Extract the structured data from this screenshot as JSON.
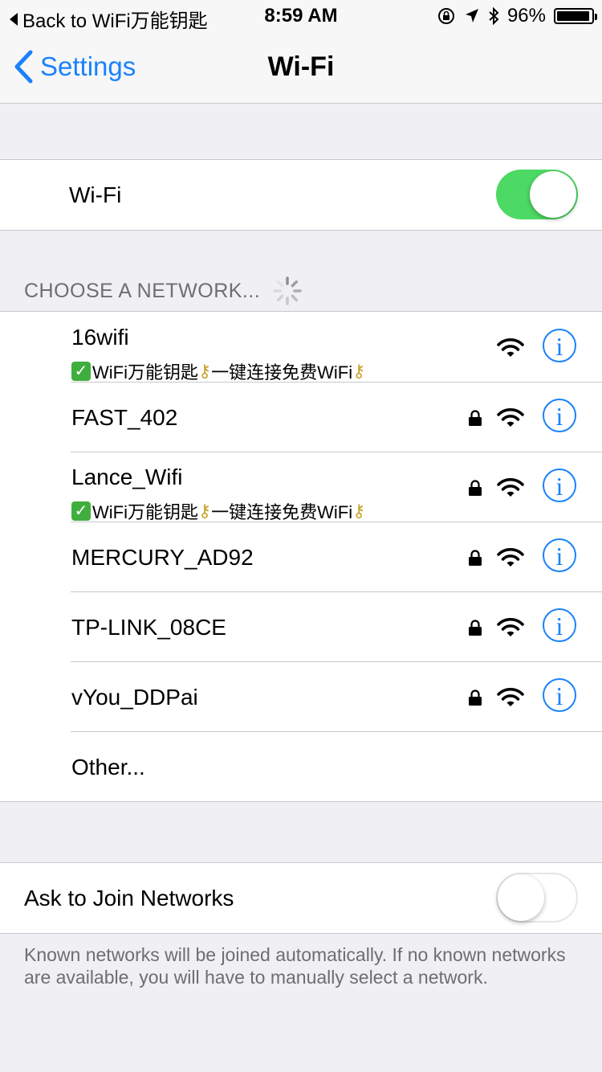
{
  "status_bar": {
    "back_label": "Back to WiFi万能钥匙",
    "time": "8:59 AM",
    "battery": "96%",
    "battery_level": 0.96
  },
  "nav": {
    "back_label": "Settings",
    "title": "Wi-Fi"
  },
  "wifi_toggle": {
    "label": "Wi-Fi",
    "on": true
  },
  "choose_header": "CHOOSE A NETWORK...",
  "networks": [
    {
      "name": "16wifi",
      "subtitle": "WiFi万能钥匙",
      "subtitle2": "一键连接免费WiFi",
      "locked": false,
      "signal": "full"
    },
    {
      "name": "FAST_402",
      "locked": true,
      "signal": "full"
    },
    {
      "name": "Lance_Wifi",
      "subtitle": "WiFi万能钥匙",
      "subtitle2": "一键连接免费WiFi",
      "locked": true,
      "signal": "full"
    },
    {
      "name": "MERCURY_AD92",
      "locked": true,
      "signal": "full"
    },
    {
      "name": "TP-LINK_08CE",
      "locked": true,
      "signal": "full"
    },
    {
      "name": "vYou_DDPai",
      "locked": true,
      "signal": "full"
    }
  ],
  "other_label": "Other...",
  "ask_toggle": {
    "label": "Ask to Join Networks",
    "on": false
  },
  "footer_text": "Known networks will be joined automatically. If no known networks are available, you will have to manually select a network.",
  "colors": {
    "accent": "#1a82fb",
    "toggle_on": "#4cd964",
    "background": "#efeff4"
  }
}
